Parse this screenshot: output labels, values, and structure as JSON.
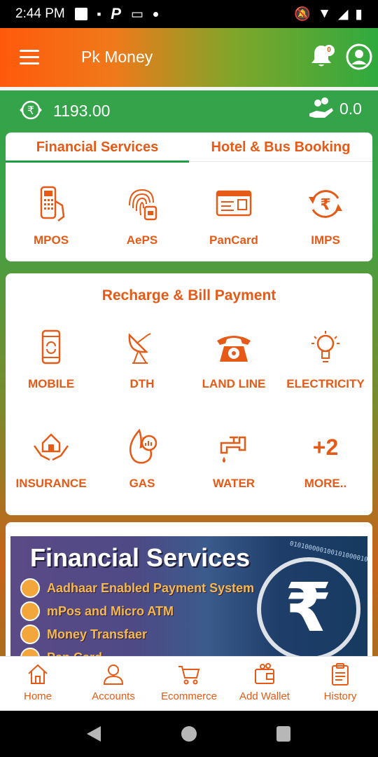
{
  "status_bar": {
    "time": "2:44 PM"
  },
  "header": {
    "title": "Pk Money",
    "notification_count": "0"
  },
  "balances": {
    "main": "1193.00",
    "cashback": "0.0"
  },
  "tabs": [
    {
      "label": "Financial Services",
      "active": true
    },
    {
      "label": "Hotel & Bus Booking",
      "active": false
    }
  ],
  "financial_services": [
    {
      "label": "MPOS",
      "icon": "card-machine-icon"
    },
    {
      "label": "AePS",
      "icon": "fingerprint-icon"
    },
    {
      "label": "PanCard",
      "icon": "id-card-icon"
    },
    {
      "label": "IMPS",
      "icon": "rupee-transfer-icon"
    }
  ],
  "recharge": {
    "title": "Recharge & Bill Payment",
    "items": [
      {
        "label": "MOBILE",
        "icon": "mobile-icon"
      },
      {
        "label": "DTH",
        "icon": "satellite-dish-icon"
      },
      {
        "label": "LAND LINE",
        "icon": "telephone-icon"
      },
      {
        "label": "ELECTRICITY",
        "icon": "bulb-icon"
      },
      {
        "label": "INSURANCE",
        "icon": "house-hands-icon"
      },
      {
        "label": "GAS",
        "icon": "flame-icon"
      },
      {
        "label": "WATER",
        "icon": "tap-icon"
      },
      {
        "label": "MORE..",
        "icon": "plus-count",
        "count": "+2"
      }
    ]
  },
  "banner": {
    "title": "Financial Services",
    "items": [
      "Aadhaar Enabled Payment System",
      "mPos and Micro ATM",
      "Money Transfaer",
      "Pan Card"
    ],
    "binary": "01010000010010100001010"
  },
  "bottom_nav": [
    {
      "label": "Home",
      "icon": "home-icon"
    },
    {
      "label": "Accounts",
      "icon": "user-icon"
    },
    {
      "label": "Ecommerce",
      "icon": "cart-icon"
    },
    {
      "label": "Add Wallet",
      "icon": "wallet-icon"
    },
    {
      "label": "History",
      "icon": "clipboard-icon"
    }
  ],
  "colors": {
    "accent": "#e55a17",
    "green": "#1aa041",
    "header_start": "#ff5a0c",
    "header_end": "#2faa3f"
  }
}
